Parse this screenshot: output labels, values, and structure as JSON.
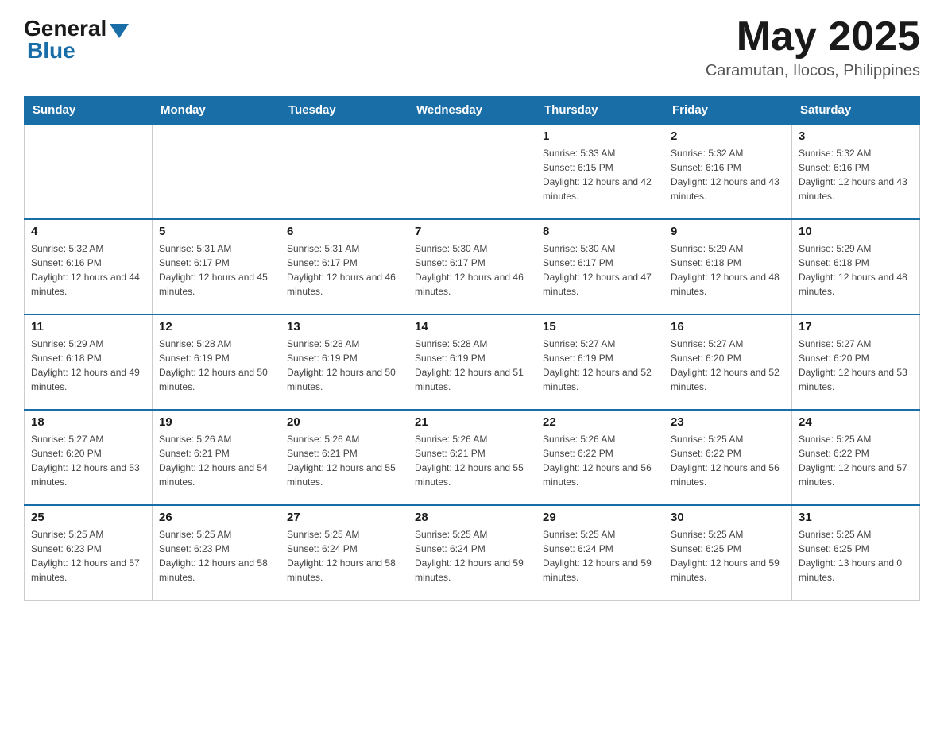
{
  "header": {
    "logo_general": "General",
    "logo_blue": "Blue",
    "month_title": "May 2025",
    "location": "Caramutan, Ilocos, Philippines"
  },
  "days_of_week": [
    "Sunday",
    "Monday",
    "Tuesday",
    "Wednesday",
    "Thursday",
    "Friday",
    "Saturday"
  ],
  "weeks": [
    [
      {
        "day": "",
        "info": ""
      },
      {
        "day": "",
        "info": ""
      },
      {
        "day": "",
        "info": ""
      },
      {
        "day": "",
        "info": ""
      },
      {
        "day": "1",
        "info": "Sunrise: 5:33 AM\nSunset: 6:15 PM\nDaylight: 12 hours and 42 minutes."
      },
      {
        "day": "2",
        "info": "Sunrise: 5:32 AM\nSunset: 6:16 PM\nDaylight: 12 hours and 43 minutes."
      },
      {
        "day": "3",
        "info": "Sunrise: 5:32 AM\nSunset: 6:16 PM\nDaylight: 12 hours and 43 minutes."
      }
    ],
    [
      {
        "day": "4",
        "info": "Sunrise: 5:32 AM\nSunset: 6:16 PM\nDaylight: 12 hours and 44 minutes."
      },
      {
        "day": "5",
        "info": "Sunrise: 5:31 AM\nSunset: 6:17 PM\nDaylight: 12 hours and 45 minutes."
      },
      {
        "day": "6",
        "info": "Sunrise: 5:31 AM\nSunset: 6:17 PM\nDaylight: 12 hours and 46 minutes."
      },
      {
        "day": "7",
        "info": "Sunrise: 5:30 AM\nSunset: 6:17 PM\nDaylight: 12 hours and 46 minutes."
      },
      {
        "day": "8",
        "info": "Sunrise: 5:30 AM\nSunset: 6:17 PM\nDaylight: 12 hours and 47 minutes."
      },
      {
        "day": "9",
        "info": "Sunrise: 5:29 AM\nSunset: 6:18 PM\nDaylight: 12 hours and 48 minutes."
      },
      {
        "day": "10",
        "info": "Sunrise: 5:29 AM\nSunset: 6:18 PM\nDaylight: 12 hours and 48 minutes."
      }
    ],
    [
      {
        "day": "11",
        "info": "Sunrise: 5:29 AM\nSunset: 6:18 PM\nDaylight: 12 hours and 49 minutes."
      },
      {
        "day": "12",
        "info": "Sunrise: 5:28 AM\nSunset: 6:19 PM\nDaylight: 12 hours and 50 minutes."
      },
      {
        "day": "13",
        "info": "Sunrise: 5:28 AM\nSunset: 6:19 PM\nDaylight: 12 hours and 50 minutes."
      },
      {
        "day": "14",
        "info": "Sunrise: 5:28 AM\nSunset: 6:19 PM\nDaylight: 12 hours and 51 minutes."
      },
      {
        "day": "15",
        "info": "Sunrise: 5:27 AM\nSunset: 6:19 PM\nDaylight: 12 hours and 52 minutes."
      },
      {
        "day": "16",
        "info": "Sunrise: 5:27 AM\nSunset: 6:20 PM\nDaylight: 12 hours and 52 minutes."
      },
      {
        "day": "17",
        "info": "Sunrise: 5:27 AM\nSunset: 6:20 PM\nDaylight: 12 hours and 53 minutes."
      }
    ],
    [
      {
        "day": "18",
        "info": "Sunrise: 5:27 AM\nSunset: 6:20 PM\nDaylight: 12 hours and 53 minutes."
      },
      {
        "day": "19",
        "info": "Sunrise: 5:26 AM\nSunset: 6:21 PM\nDaylight: 12 hours and 54 minutes."
      },
      {
        "day": "20",
        "info": "Sunrise: 5:26 AM\nSunset: 6:21 PM\nDaylight: 12 hours and 55 minutes."
      },
      {
        "day": "21",
        "info": "Sunrise: 5:26 AM\nSunset: 6:21 PM\nDaylight: 12 hours and 55 minutes."
      },
      {
        "day": "22",
        "info": "Sunrise: 5:26 AM\nSunset: 6:22 PM\nDaylight: 12 hours and 56 minutes."
      },
      {
        "day": "23",
        "info": "Sunrise: 5:25 AM\nSunset: 6:22 PM\nDaylight: 12 hours and 56 minutes."
      },
      {
        "day": "24",
        "info": "Sunrise: 5:25 AM\nSunset: 6:22 PM\nDaylight: 12 hours and 57 minutes."
      }
    ],
    [
      {
        "day": "25",
        "info": "Sunrise: 5:25 AM\nSunset: 6:23 PM\nDaylight: 12 hours and 57 minutes."
      },
      {
        "day": "26",
        "info": "Sunrise: 5:25 AM\nSunset: 6:23 PM\nDaylight: 12 hours and 58 minutes."
      },
      {
        "day": "27",
        "info": "Sunrise: 5:25 AM\nSunset: 6:24 PM\nDaylight: 12 hours and 58 minutes."
      },
      {
        "day": "28",
        "info": "Sunrise: 5:25 AM\nSunset: 6:24 PM\nDaylight: 12 hours and 59 minutes."
      },
      {
        "day": "29",
        "info": "Sunrise: 5:25 AM\nSunset: 6:24 PM\nDaylight: 12 hours and 59 minutes."
      },
      {
        "day": "30",
        "info": "Sunrise: 5:25 AM\nSunset: 6:25 PM\nDaylight: 12 hours and 59 minutes."
      },
      {
        "day": "31",
        "info": "Sunrise: 5:25 AM\nSunset: 6:25 PM\nDaylight: 13 hours and 0 minutes."
      }
    ]
  ]
}
